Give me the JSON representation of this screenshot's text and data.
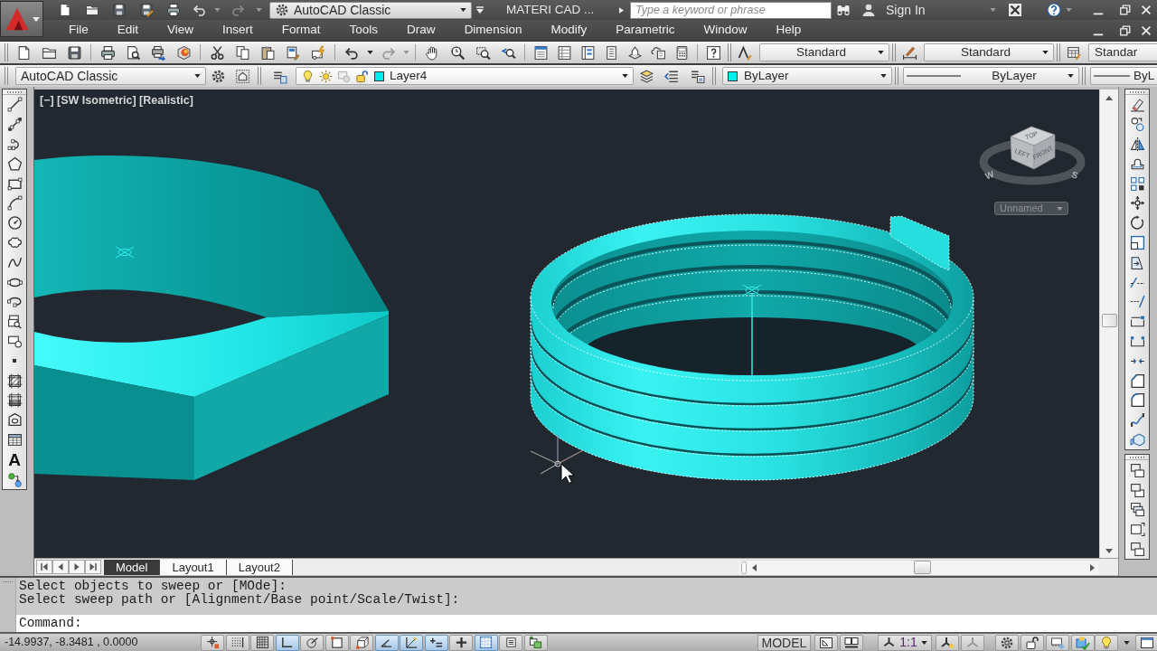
{
  "title_bar": {
    "workspace": "AutoCAD Classic",
    "title": "MATERI CAD ...",
    "search": {
      "placeholder": "Type a keyword or phrase"
    },
    "sign_in": "Sign In"
  },
  "menu_bar": [
    "File",
    "Edit",
    "View",
    "Insert",
    "Format",
    "Tools",
    "Draw",
    "Dimension",
    "Modify",
    "Parametric",
    "Window",
    "Help"
  ],
  "styles_toolbar": {
    "text_style": "Standard",
    "dimension_style": "Standard",
    "table_style": "Standar"
  },
  "workspaces_toolbar": {
    "workspace": "AutoCAD Classic"
  },
  "layers_toolbar": {
    "layer": "Layer4"
  },
  "properties_toolbar": {
    "dropdowns": [
      "ByLayer",
      "ByLayer",
      "ByL"
    ]
  },
  "draw_toolbar": {
    "text_tool": "A"
  },
  "viewport": {
    "label": "[−] [SW Isometric] [Realistic]",
    "viewcube": {
      "faces": [
        "TOP",
        "LEFT",
        "FRONT"
      ],
      "compass": [
        "W",
        "S"
      ],
      "view_name": "Unnamed"
    }
  },
  "layout_tabs": [
    {
      "label": "Model",
      "selected": true
    },
    {
      "label": "Layout1",
      "selected": false
    },
    {
      "label": "Layout2",
      "selected": false
    }
  ],
  "command_line": {
    "history": [
      "Select objects to sweep or [MOde]:",
      "Select sweep path or [Alignment/Base point/Scale/Twist]:"
    ],
    "prompt": "Command:"
  },
  "status_bar": {
    "coordinates": "-14.9937, -8.3481 , 0.0000",
    "toggles": [
      {
        "on": false
      },
      {
        "on": false
      },
      {
        "on": false
      },
      {
        "on": true
      },
      {
        "on": false
      },
      {
        "on": false
      },
      {
        "on": false
      },
      {
        "on": true
      },
      {
        "on": true
      },
      {
        "on": true
      },
      {
        "on": false
      },
      {
        "on": true
      },
      {
        "on": false
      },
      {
        "on": false
      }
    ],
    "space": "MODEL",
    "annotation_scale": "1:1"
  }
}
